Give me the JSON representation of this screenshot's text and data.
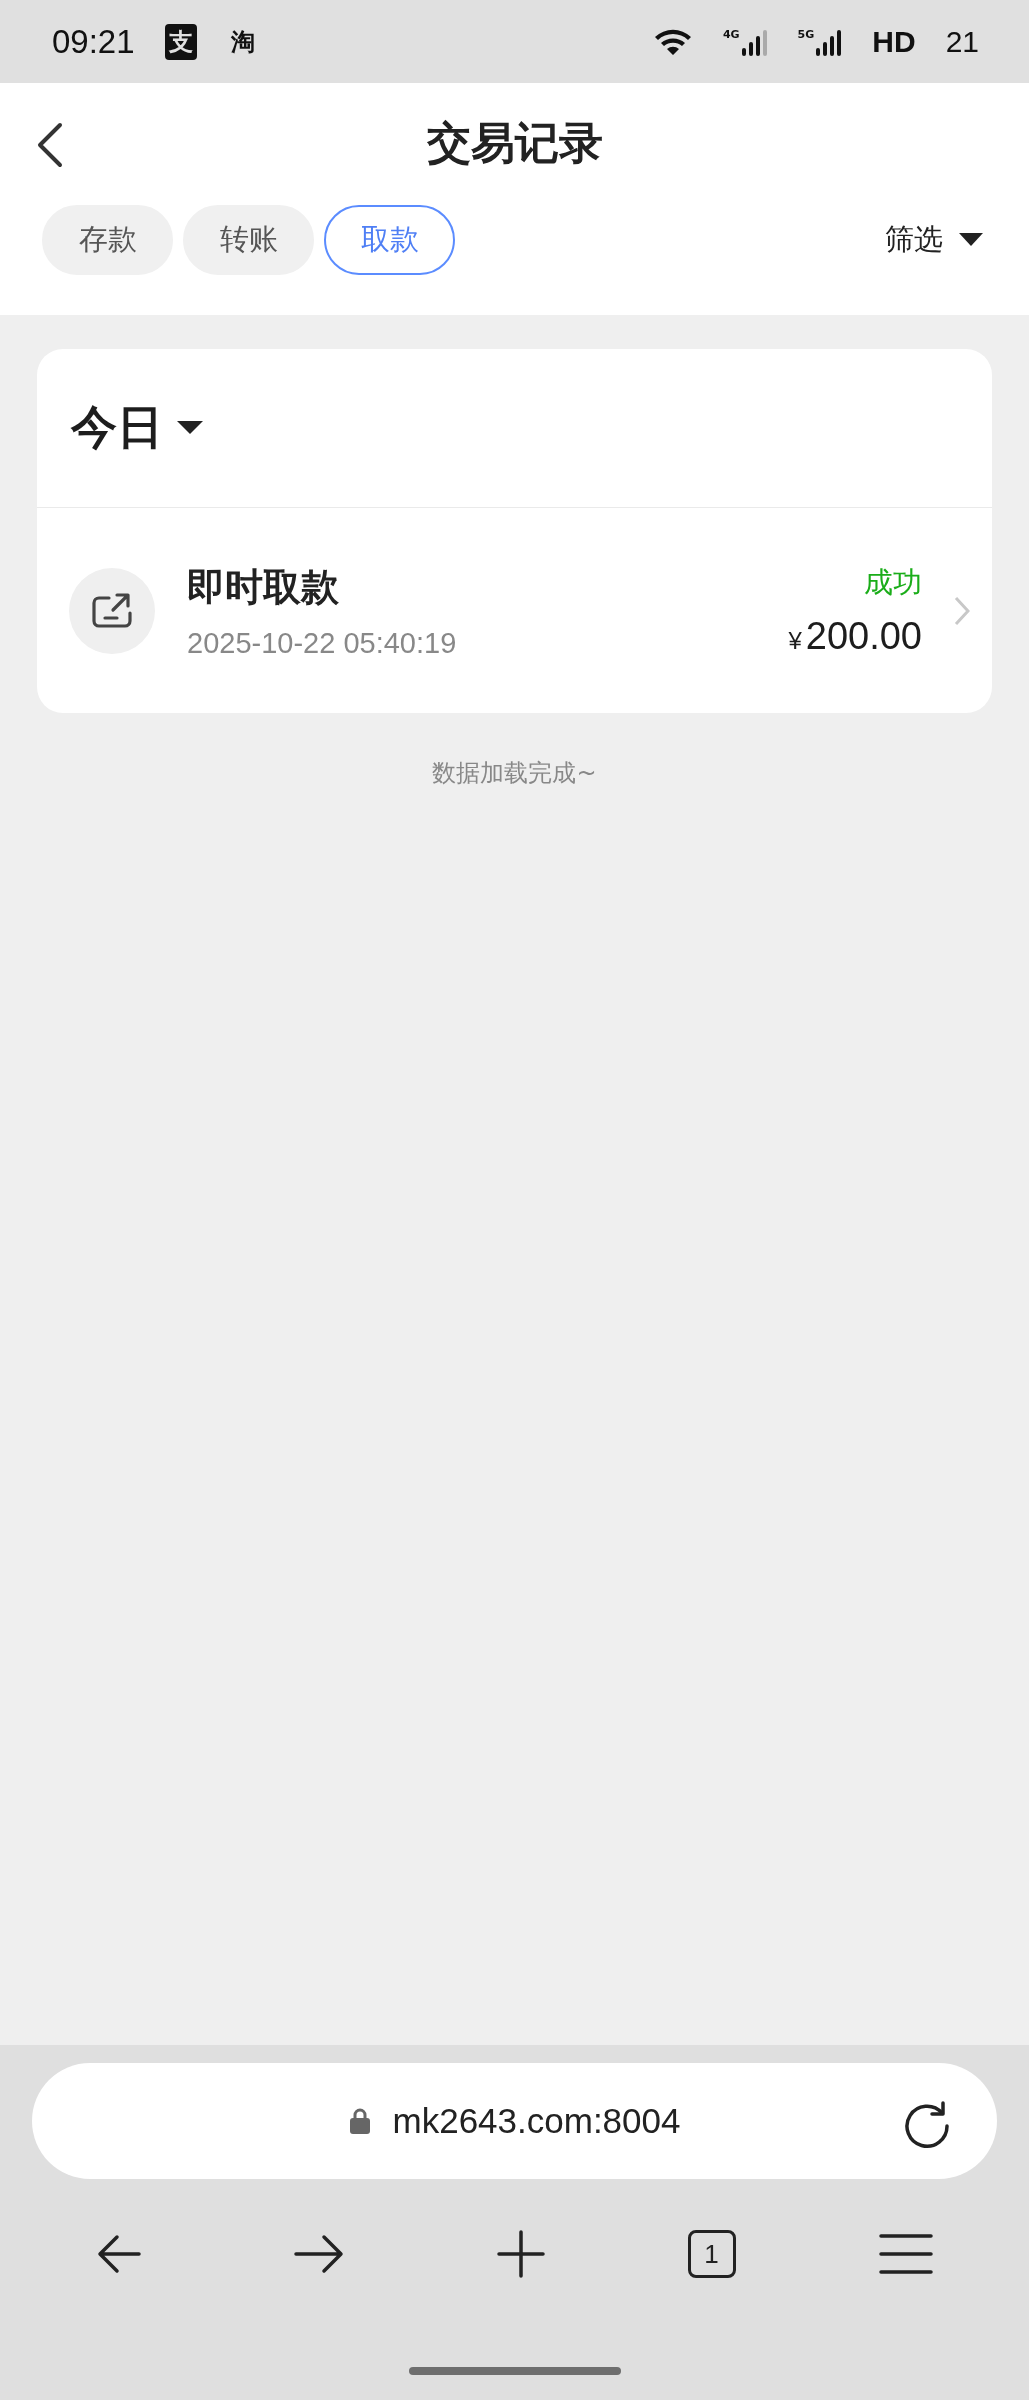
{
  "status_bar": {
    "time": "09:21",
    "app_icons": [
      "支",
      "淘"
    ],
    "signals": [
      {
        "label": "4G"
      },
      {
        "label": "5G"
      }
    ],
    "network": "HD",
    "battery": "21"
  },
  "header": {
    "title": "交易记录"
  },
  "tabs": [
    {
      "label": "存款",
      "selected": false
    },
    {
      "label": "转账",
      "selected": false
    },
    {
      "label": "取款",
      "selected": true
    }
  ],
  "filter": {
    "label": "筛选"
  },
  "group": {
    "title": "今日",
    "records": [
      {
        "name": "即时取款",
        "time": "2025-10-22 05:40:19",
        "status": "成功",
        "color": "#1aad19",
        "currency": "¥",
        "amount": "200.00"
      }
    ]
  },
  "footer_note": "数据加载完成~",
  "browser": {
    "url": "mk2643.com:8004",
    "tab_count": "1"
  }
}
